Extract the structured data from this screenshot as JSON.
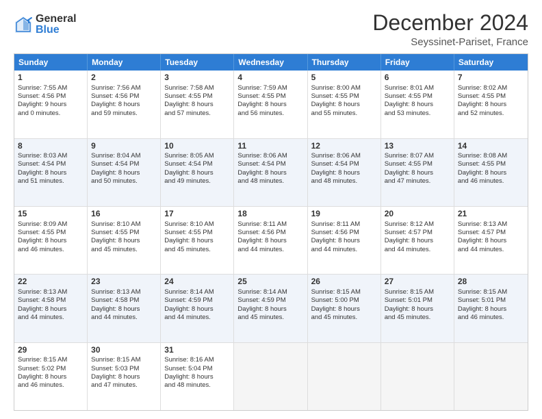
{
  "logo": {
    "general": "General",
    "blue": "Blue"
  },
  "header": {
    "title": "December 2024",
    "subtitle": "Seyssinet-Pariset, France"
  },
  "weekdays": [
    "Sunday",
    "Monday",
    "Tuesday",
    "Wednesday",
    "Thursday",
    "Friday",
    "Saturday"
  ],
  "weeks": [
    [
      {
        "day": "1",
        "lines": [
          "Sunrise: 7:55 AM",
          "Sunset: 4:56 PM",
          "Daylight: 9 hours",
          "and 0 minutes."
        ],
        "alt": false
      },
      {
        "day": "2",
        "lines": [
          "Sunrise: 7:56 AM",
          "Sunset: 4:56 PM",
          "Daylight: 8 hours",
          "and 59 minutes."
        ],
        "alt": false
      },
      {
        "day": "3",
        "lines": [
          "Sunrise: 7:58 AM",
          "Sunset: 4:55 PM",
          "Daylight: 8 hours",
          "and 57 minutes."
        ],
        "alt": false
      },
      {
        "day": "4",
        "lines": [
          "Sunrise: 7:59 AM",
          "Sunset: 4:55 PM",
          "Daylight: 8 hours",
          "and 56 minutes."
        ],
        "alt": false
      },
      {
        "day": "5",
        "lines": [
          "Sunrise: 8:00 AM",
          "Sunset: 4:55 PM",
          "Daylight: 8 hours",
          "and 55 minutes."
        ],
        "alt": false
      },
      {
        "day": "6",
        "lines": [
          "Sunrise: 8:01 AM",
          "Sunset: 4:55 PM",
          "Daylight: 8 hours",
          "and 53 minutes."
        ],
        "alt": false
      },
      {
        "day": "7",
        "lines": [
          "Sunrise: 8:02 AM",
          "Sunset: 4:55 PM",
          "Daylight: 8 hours",
          "and 52 minutes."
        ],
        "alt": false
      }
    ],
    [
      {
        "day": "8",
        "lines": [
          "Sunrise: 8:03 AM",
          "Sunset: 4:54 PM",
          "Daylight: 8 hours",
          "and 51 minutes."
        ],
        "alt": true
      },
      {
        "day": "9",
        "lines": [
          "Sunrise: 8:04 AM",
          "Sunset: 4:54 PM",
          "Daylight: 8 hours",
          "and 50 minutes."
        ],
        "alt": true
      },
      {
        "day": "10",
        "lines": [
          "Sunrise: 8:05 AM",
          "Sunset: 4:54 PM",
          "Daylight: 8 hours",
          "and 49 minutes."
        ],
        "alt": true
      },
      {
        "day": "11",
        "lines": [
          "Sunrise: 8:06 AM",
          "Sunset: 4:54 PM",
          "Daylight: 8 hours",
          "and 48 minutes."
        ],
        "alt": true
      },
      {
        "day": "12",
        "lines": [
          "Sunrise: 8:06 AM",
          "Sunset: 4:54 PM",
          "Daylight: 8 hours",
          "and 48 minutes."
        ],
        "alt": true
      },
      {
        "day": "13",
        "lines": [
          "Sunrise: 8:07 AM",
          "Sunset: 4:55 PM",
          "Daylight: 8 hours",
          "and 47 minutes."
        ],
        "alt": true
      },
      {
        "day": "14",
        "lines": [
          "Sunrise: 8:08 AM",
          "Sunset: 4:55 PM",
          "Daylight: 8 hours",
          "and 46 minutes."
        ],
        "alt": true
      }
    ],
    [
      {
        "day": "15",
        "lines": [
          "Sunrise: 8:09 AM",
          "Sunset: 4:55 PM",
          "Daylight: 8 hours",
          "and 46 minutes."
        ],
        "alt": false
      },
      {
        "day": "16",
        "lines": [
          "Sunrise: 8:10 AM",
          "Sunset: 4:55 PM",
          "Daylight: 8 hours",
          "and 45 minutes."
        ],
        "alt": false
      },
      {
        "day": "17",
        "lines": [
          "Sunrise: 8:10 AM",
          "Sunset: 4:55 PM",
          "Daylight: 8 hours",
          "and 45 minutes."
        ],
        "alt": false
      },
      {
        "day": "18",
        "lines": [
          "Sunrise: 8:11 AM",
          "Sunset: 4:56 PM",
          "Daylight: 8 hours",
          "and 44 minutes."
        ],
        "alt": false
      },
      {
        "day": "19",
        "lines": [
          "Sunrise: 8:11 AM",
          "Sunset: 4:56 PM",
          "Daylight: 8 hours",
          "and 44 minutes."
        ],
        "alt": false
      },
      {
        "day": "20",
        "lines": [
          "Sunrise: 8:12 AM",
          "Sunset: 4:57 PM",
          "Daylight: 8 hours",
          "and 44 minutes."
        ],
        "alt": false
      },
      {
        "day": "21",
        "lines": [
          "Sunrise: 8:13 AM",
          "Sunset: 4:57 PM",
          "Daylight: 8 hours",
          "and 44 minutes."
        ],
        "alt": false
      }
    ],
    [
      {
        "day": "22",
        "lines": [
          "Sunrise: 8:13 AM",
          "Sunset: 4:58 PM",
          "Daylight: 8 hours",
          "and 44 minutes."
        ],
        "alt": true
      },
      {
        "day": "23",
        "lines": [
          "Sunrise: 8:13 AM",
          "Sunset: 4:58 PM",
          "Daylight: 8 hours",
          "and 44 minutes."
        ],
        "alt": true
      },
      {
        "day": "24",
        "lines": [
          "Sunrise: 8:14 AM",
          "Sunset: 4:59 PM",
          "Daylight: 8 hours",
          "and 44 minutes."
        ],
        "alt": true
      },
      {
        "day": "25",
        "lines": [
          "Sunrise: 8:14 AM",
          "Sunset: 4:59 PM",
          "Daylight: 8 hours",
          "and 45 minutes."
        ],
        "alt": true
      },
      {
        "day": "26",
        "lines": [
          "Sunrise: 8:15 AM",
          "Sunset: 5:00 PM",
          "Daylight: 8 hours",
          "and 45 minutes."
        ],
        "alt": true
      },
      {
        "day": "27",
        "lines": [
          "Sunrise: 8:15 AM",
          "Sunset: 5:01 PM",
          "Daylight: 8 hours",
          "and 45 minutes."
        ],
        "alt": true
      },
      {
        "day": "28",
        "lines": [
          "Sunrise: 8:15 AM",
          "Sunset: 5:01 PM",
          "Daylight: 8 hours",
          "and 46 minutes."
        ],
        "alt": true
      }
    ],
    [
      {
        "day": "29",
        "lines": [
          "Sunrise: 8:15 AM",
          "Sunset: 5:02 PM",
          "Daylight: 8 hours",
          "and 46 minutes."
        ],
        "alt": false
      },
      {
        "day": "30",
        "lines": [
          "Sunrise: 8:15 AM",
          "Sunset: 5:03 PM",
          "Daylight: 8 hours",
          "and 47 minutes."
        ],
        "alt": false
      },
      {
        "day": "31",
        "lines": [
          "Sunrise: 8:16 AM",
          "Sunset: 5:04 PM",
          "Daylight: 8 hours",
          "and 48 minutes."
        ],
        "alt": false
      },
      {
        "day": "",
        "lines": [],
        "alt": false,
        "empty": true
      },
      {
        "day": "",
        "lines": [],
        "alt": false,
        "empty": true
      },
      {
        "day": "",
        "lines": [],
        "alt": false,
        "empty": true
      },
      {
        "day": "",
        "lines": [],
        "alt": false,
        "empty": true
      }
    ]
  ]
}
